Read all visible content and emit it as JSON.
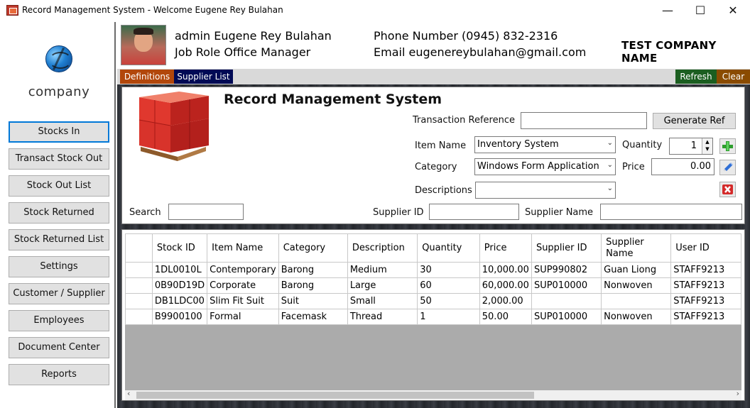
{
  "window": {
    "title": "Record Management System - Welcome Eugene Rey Bulahan",
    "controls": {
      "minimize": "—",
      "maximize": "☐",
      "close": "✕"
    }
  },
  "sidebar": {
    "logo_text": "company",
    "items": [
      {
        "label": "Stocks In",
        "active": true
      },
      {
        "label": "Transact Stock Out"
      },
      {
        "label": "Stock Out List"
      },
      {
        "label": "Stock Returned"
      },
      {
        "label": "Stock Returned List"
      },
      {
        "label": "Settings"
      },
      {
        "label": "Customer / Supplier"
      },
      {
        "label": "Employees"
      },
      {
        "label": "Document Center"
      },
      {
        "label": "Reports"
      }
    ]
  },
  "header": {
    "user": "admin Eugene Rey Bulahan",
    "role": "Job Role Office Manager",
    "phone": "Phone Number (0945) 832-2316",
    "email": "Email eugenereybulahan@gmail.com",
    "company": "TEST COMPANY NAME"
  },
  "tabs": {
    "definitions": "Definitions",
    "supplier_list": "Supplier List",
    "refresh": "Refresh",
    "clear": "Clear",
    "colors": {
      "definitions": "#b2470b",
      "supplier_list": "#000a55",
      "refresh": "#1b5e20",
      "clear": "#8a4b00"
    }
  },
  "form": {
    "title": "Record Management System",
    "transaction_reference_label": "Transaction Reference",
    "transaction_reference_value": "",
    "generate_ref": "Generate Ref",
    "item_name_label": "Item Name",
    "item_name_value": "Inventory System",
    "quantity_label": "Quantity",
    "quantity_value": "1",
    "category_label": "Category",
    "category_value": "Windows Form Application",
    "price_label": "Price",
    "price_value": "0.00",
    "descriptions_label": "Descriptions",
    "descriptions_value": "",
    "search_label": "Search",
    "search_value": "",
    "supplier_id_label": "Supplier ID",
    "supplier_id_value": "",
    "supplier_name_label": "Supplier Name",
    "supplier_name_value": ""
  },
  "grid": {
    "columns": [
      "Stock ID",
      "Item Name",
      "Category",
      "Description",
      "Quantity",
      "Price",
      "Supplier ID",
      "Supplier Name",
      "User ID"
    ],
    "rows": [
      [
        "1DL0010L",
        "Contemporary",
        "Barong",
        "Medium",
        "30",
        "10,000.00",
        "SUP990802",
        "Guan Liong",
        "STAFF9213"
      ],
      [
        "0B90D19D",
        "Corporate",
        "Barong",
        "Large",
        "60",
        "60,000.00",
        "SUP010000",
        "Nonwoven",
        "STAFF9213"
      ],
      [
        "DB1LDC00",
        "Slim Fit Suit",
        "Suit",
        "Small",
        "50",
        "2,000.00",
        "",
        "",
        "STAFF9213"
      ],
      [
        "B9900100",
        "Formal",
        "Facemask",
        "Thread",
        "1",
        "50.00",
        "SUP010000",
        "Nonwoven",
        "STAFF9213"
      ]
    ]
  }
}
